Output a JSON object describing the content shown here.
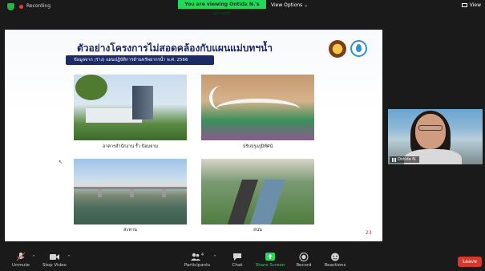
{
  "top_bar": {
    "recording_label": "Recording",
    "viewing_banner": "You are viewing Ontida N.'s screen",
    "view_options_label": "View Options",
    "view_options_caret": "⌄",
    "view_label": "View"
  },
  "slide": {
    "title": "ตัวอย่างโครงการไม่สอดคล้องกับแผนแม่บทฯน้ำ",
    "subtitle": "ข้อมูลจาก (ร่าง) แผนปฏิบัติการด้านทรัพยากรน้ำ พ.ศ. 2566",
    "captions": [
      "อาคารสำนักงาน รั้ว ป้อมยาม",
      "ปรับปรุงภูมิทัศน์",
      "สะพาน",
      "ถนน"
    ],
    "page_number": "23",
    "cursor_mark": "↖"
  },
  "participant": {
    "name": "Ontida N."
  },
  "toolbar": {
    "items": [
      {
        "label": "Unmute",
        "icon": "mic-muted-icon"
      },
      {
        "label": "Stop Video",
        "icon": "video-icon"
      },
      {
        "label": "Participants",
        "icon": "participants-icon",
        "count": "4"
      },
      {
        "label": "Chat",
        "icon": "chat-icon"
      },
      {
        "label": "Share Screen",
        "icon": "share-screen-icon"
      },
      {
        "label": "Record",
        "icon": "record-icon"
      },
      {
        "label": "Reactions",
        "icon": "reactions-icon"
      }
    ],
    "leave_label": "Leave"
  },
  "colors": {
    "viewing_banner": "#23d959",
    "share_screen": "#23d959",
    "leave": "#d4382f",
    "title_navy": "#1c2a66"
  }
}
